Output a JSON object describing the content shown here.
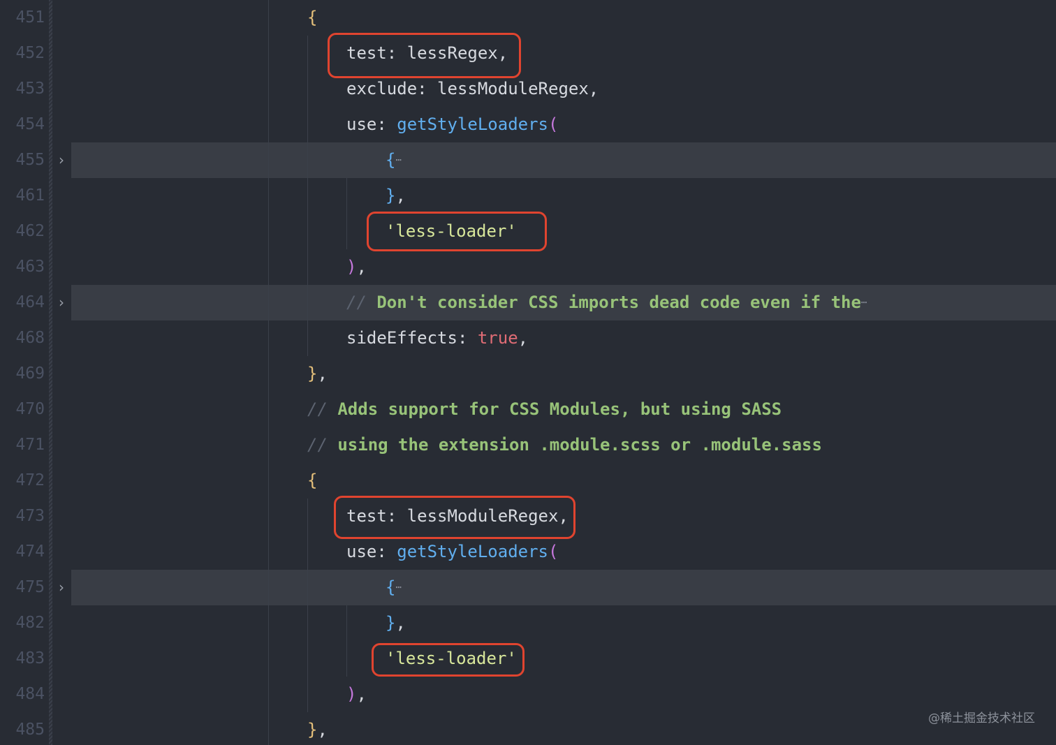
{
  "editor": {
    "lines": [
      {
        "n": "451",
        "tokens": [
          {
            "t": "{",
            "c": "t-brace1"
          }
        ]
      },
      {
        "n": "452",
        "tokens": [
          {
            "t": "test: ",
            "c": "t-punct"
          },
          {
            "t": "lessRegex,",
            "c": "t-punct"
          }
        ]
      },
      {
        "n": "453",
        "tokens": [
          {
            "t": "exclude: ",
            "c": "t-punct"
          },
          {
            "t": "lessModuleRegex,",
            "c": "t-punct"
          }
        ]
      },
      {
        "n": "454",
        "tokens": [
          {
            "t": "use: ",
            "c": "t-punct"
          },
          {
            "t": "getStyleLoaders",
            "c": "t-func"
          },
          {
            "t": "(",
            "c": "t-paren"
          }
        ]
      },
      {
        "n": "455",
        "folded": true,
        "tokens": [
          {
            "t": "{",
            "c": "t-brace2"
          },
          {
            "t": "⋯",
            "c": "ellipsis"
          }
        ]
      },
      {
        "n": "461",
        "tokens": [
          {
            "t": "}",
            "c": "t-brace2"
          },
          {
            "t": ",",
            "c": "t-punct"
          }
        ]
      },
      {
        "n": "462",
        "tokens": [
          {
            "t": "'less-loader'",
            "c": "t-str"
          }
        ]
      },
      {
        "n": "463",
        "tokens": [
          {
            "t": ")",
            "c": "t-paren"
          },
          {
            "t": ",",
            "c": "t-punct"
          }
        ]
      },
      {
        "n": "464",
        "folded": true,
        "tokens": [
          {
            "t": "// ",
            "c": "t-cslash"
          },
          {
            "t": "Don't consider CSS imports dead code even if the",
            "c": "t-comment"
          },
          {
            "t": "⋯",
            "c": "ellipsis"
          }
        ]
      },
      {
        "n": "468",
        "tokens": [
          {
            "t": "sideEffects: ",
            "c": "t-punct"
          },
          {
            "t": "true",
            "c": "t-bool"
          },
          {
            "t": ",",
            "c": "t-punct"
          }
        ]
      },
      {
        "n": "469",
        "tokens": [
          {
            "t": "}",
            "c": "t-brace1"
          },
          {
            "t": ",",
            "c": "t-punct"
          }
        ]
      },
      {
        "n": "470",
        "tokens": [
          {
            "t": "// ",
            "c": "t-cslash"
          },
          {
            "t": "Adds support for CSS Modules, but using SASS",
            "c": "t-comment"
          }
        ]
      },
      {
        "n": "471",
        "tokens": [
          {
            "t": "// ",
            "c": "t-cslash"
          },
          {
            "t": "using the extension .module.scss or .module.sass",
            "c": "t-comment"
          }
        ]
      },
      {
        "n": "472",
        "tokens": [
          {
            "t": "{",
            "c": "t-brace1"
          }
        ]
      },
      {
        "n": "473",
        "tokens": [
          {
            "t": "test: ",
            "c": "t-punct"
          },
          {
            "t": "lessModuleRegex,",
            "c": "t-punct"
          }
        ]
      },
      {
        "n": "474",
        "tokens": [
          {
            "t": "use: ",
            "c": "t-punct"
          },
          {
            "t": "getStyleLoaders",
            "c": "t-func"
          },
          {
            "t": "(",
            "c": "t-paren"
          }
        ]
      },
      {
        "n": "475",
        "folded": true,
        "tokens": [
          {
            "t": "{",
            "c": "t-brace2"
          },
          {
            "t": "⋯",
            "c": "ellipsis"
          }
        ]
      },
      {
        "n": "482",
        "tokens": [
          {
            "t": "}",
            "c": "t-brace2"
          },
          {
            "t": ",",
            "c": "t-punct"
          }
        ]
      },
      {
        "n": "483",
        "tokens": [
          {
            "t": "'less-loader'",
            "c": "t-str"
          }
        ]
      },
      {
        "n": "484",
        "tokens": [
          {
            "t": ")",
            "c": "t-paren"
          },
          {
            "t": ",",
            "c": "t-punct"
          }
        ]
      },
      {
        "n": "485",
        "tokens": [
          {
            "t": "}",
            "c": "t-brace1"
          },
          {
            "t": ",",
            "c": "t-punct"
          }
        ]
      }
    ],
    "fold_icon": "chevron-right-icon"
  },
  "watermark": "@稀土掘金技术社区",
  "colors": {
    "background": "#282c34",
    "highlight_box": "#e0442f",
    "folded_line": "#393d45"
  }
}
